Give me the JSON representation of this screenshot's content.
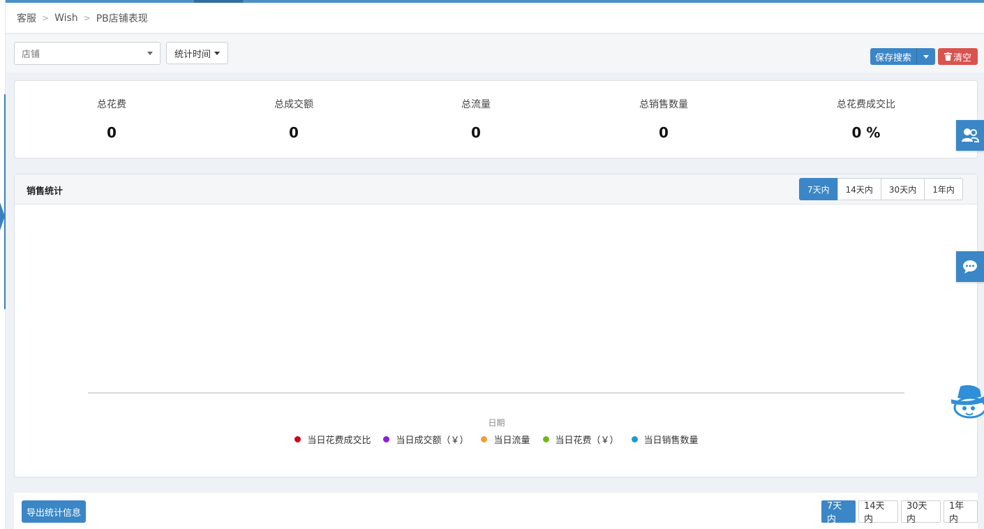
{
  "breadcrumb": [
    "客服",
    "Wish",
    "PB店铺表现"
  ],
  "filters": {
    "shop_placeholder": "店铺",
    "time_label": "统计时间",
    "save_search": "保存搜索",
    "clear": "清空"
  },
  "stats": [
    {
      "label": "总花费",
      "value": "0"
    },
    {
      "label": "总成交额",
      "value": "0"
    },
    {
      "label": "总流量",
      "value": "0"
    },
    {
      "label": "总销售数量",
      "value": "0"
    },
    {
      "label": "总花费成交比",
      "value": "0 %"
    }
  ],
  "sales_panel": {
    "title": "销售统计",
    "ranges": [
      "7天内",
      "14天内",
      "30天内",
      "1年内"
    ],
    "active_range": "7天内"
  },
  "chart_data": {
    "type": "line",
    "xlabel": "日期",
    "x": [],
    "series": [
      {
        "name": "当日花费成交比",
        "color": "#d0021b",
        "values": []
      },
      {
        "name": "当日成交额（￥）",
        "color": "#8b1fe0",
        "values": []
      },
      {
        "name": "当日流量",
        "color": "#f39c34",
        "values": []
      },
      {
        "name": "当日花费（￥）",
        "color": "#6fba1c",
        "values": []
      },
      {
        "name": "当日销售数量",
        "color": "#1a9ad6",
        "values": []
      }
    ],
    "legend_position": "bottom"
  },
  "bottom": {
    "export_label": "导出统计信息",
    "ranges": [
      "7天内",
      "14天内",
      "30天内",
      "1年内"
    ],
    "active_range": "7天内"
  },
  "side_icons": [
    "customer-service-icon",
    "chat-icon",
    "mascot-icon"
  ]
}
